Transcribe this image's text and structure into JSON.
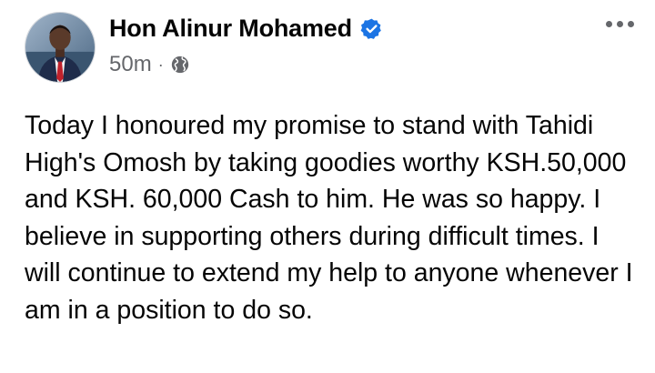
{
  "post": {
    "author": "Hon Alinur Mohamed",
    "timestamp": "50m",
    "separator": "·",
    "audience_icon": "globe-icon",
    "verified_icon": "verified-badge-icon",
    "more_icon": "more-options-icon",
    "text": "Today I honoured my promise to stand with Tahidi High's Omosh by taking goodies worthy KSH.50,000 and KSH. 60,000 Cash to him. He was so happy. I believe in supporting others during difficult times. I will continue to extend my help to anyone whenever I am in a position to do so."
  },
  "colors": {
    "verified": "#1b74e4",
    "secondary_text": "#65676b",
    "primary_text": "#050505"
  }
}
